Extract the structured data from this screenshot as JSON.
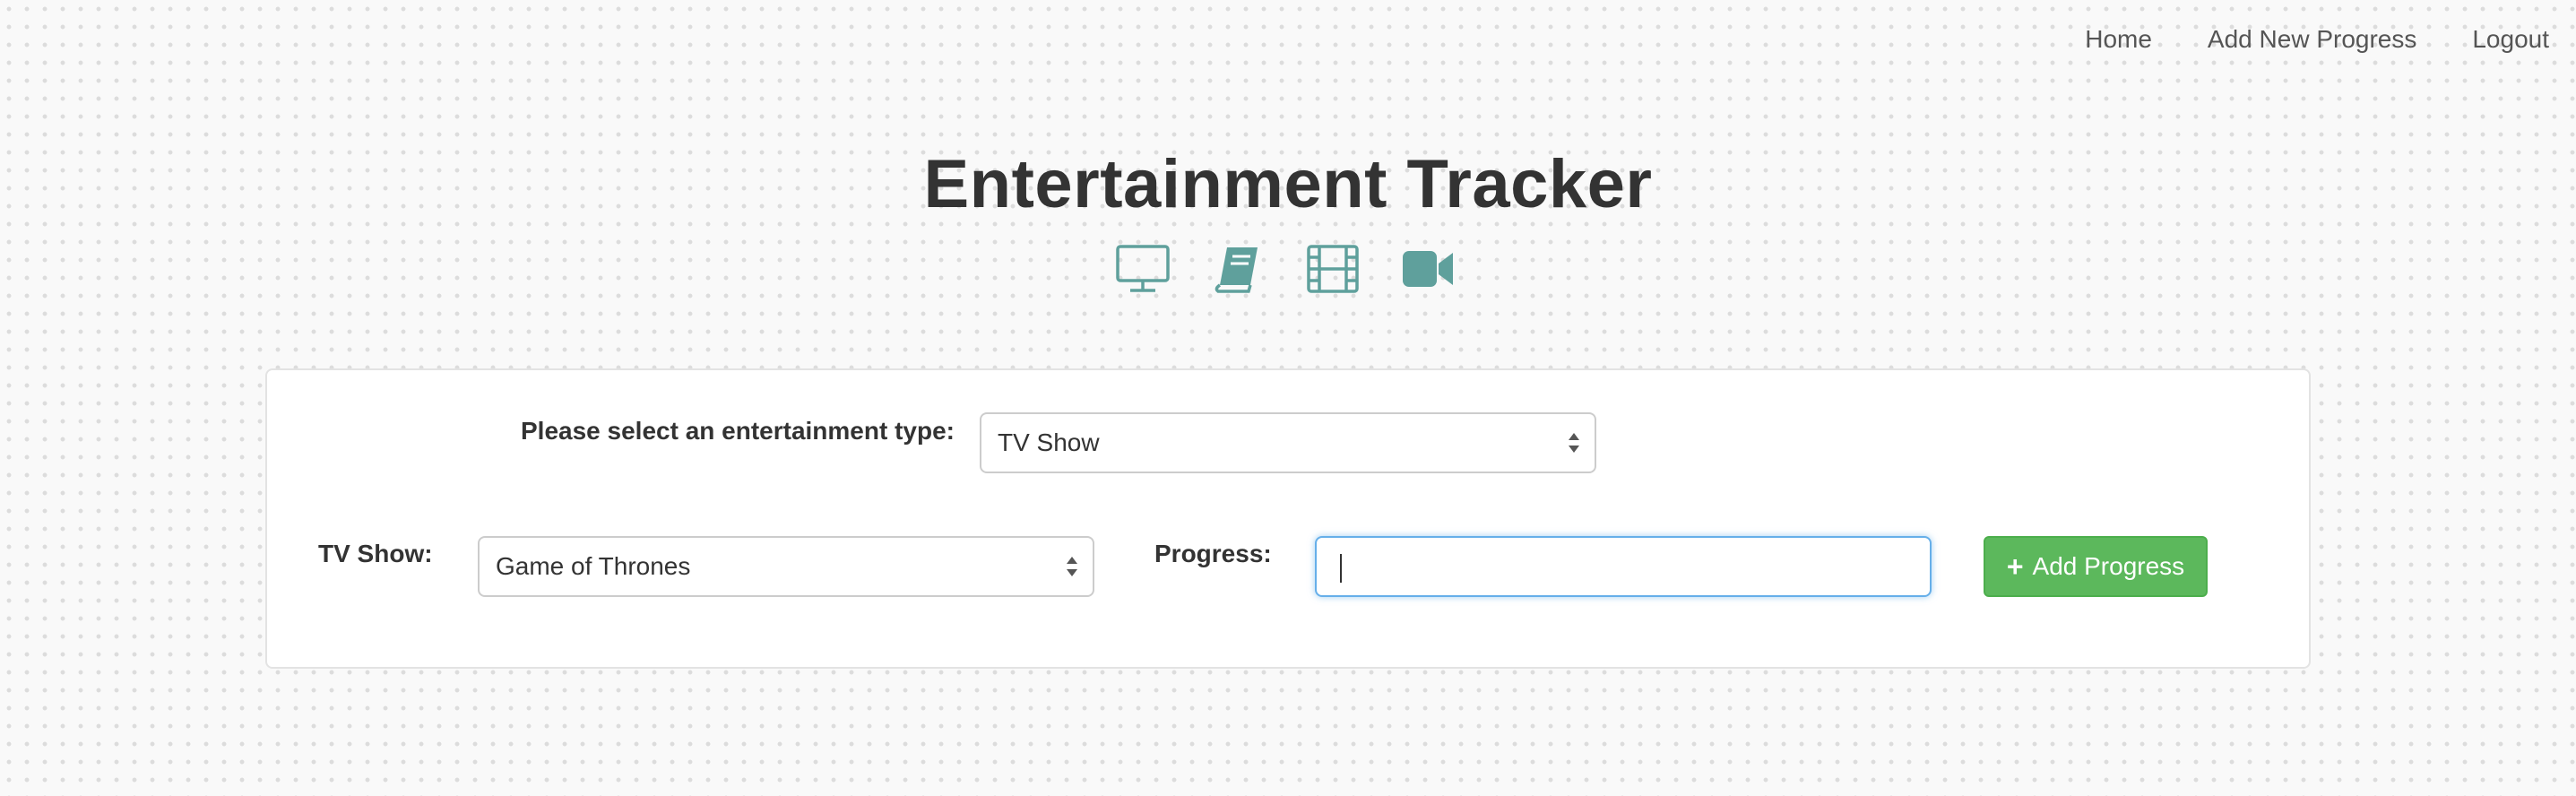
{
  "nav": {
    "home": "Home",
    "add_new_progress": "Add New Progress",
    "logout": "Logout"
  },
  "page": {
    "title": "Entertainment Tracker",
    "icons": [
      "tv-icon",
      "book-icon",
      "film-icon",
      "video-camera-icon"
    ],
    "icon_color": "#5fa09c"
  },
  "form": {
    "type_label": "Please select an entertainment type:",
    "type_value": "TV Show",
    "show_label": "TV Show:",
    "show_value": "Game of Thrones",
    "progress_label": "Progress:",
    "progress_value": "",
    "add_button": "Add Progress",
    "add_button_icon": "plus-icon",
    "button_color": "#5cb85c"
  }
}
